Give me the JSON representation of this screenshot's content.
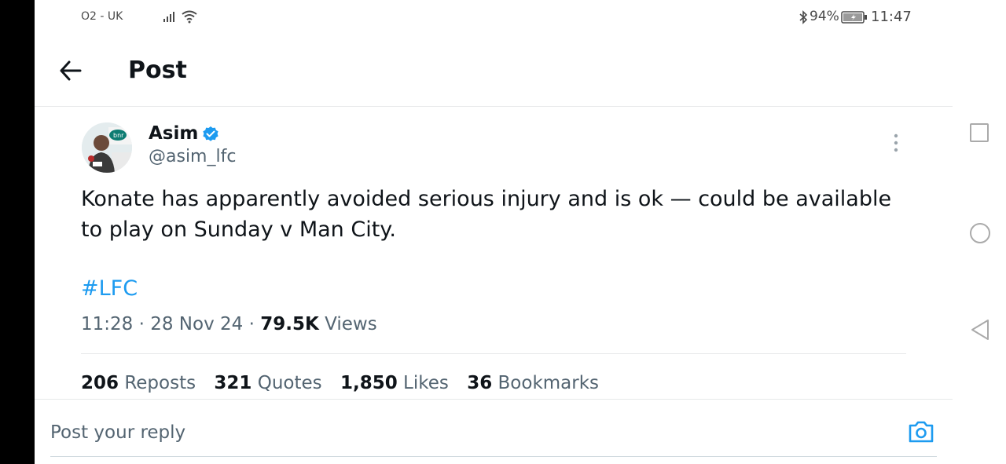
{
  "status_bar": {
    "carrier": "O2 - UK",
    "battery": "94%",
    "time": "11:47",
    "icons": [
      "signal-icon",
      "wifi-icon",
      "bluetooth-icon",
      "battery-icon"
    ]
  },
  "header": {
    "title": "Post",
    "back_icon": "arrow-left-icon"
  },
  "post": {
    "author_name": "Asim",
    "verified": true,
    "handle": "@asim_lfc",
    "text": "Konate has apparently avoided serious injury and is ok — could be available to play on Sunday v Man City.",
    "hashtag": "#LFC",
    "time": "11:28",
    "date": "28 Nov 24",
    "views_count": "79.5K",
    "views_label": "Views",
    "separator": "·"
  },
  "stats": [
    {
      "count": "206",
      "label": "Reposts"
    },
    {
      "count": "321",
      "label": "Quotes"
    },
    {
      "count": "1,850",
      "label": "Likes"
    },
    {
      "count": "36",
      "label": "Bookmarks"
    }
  ],
  "reply": {
    "placeholder": "Post your reply"
  },
  "colors": {
    "accent": "#1d9bf0",
    "text": "#0f1419",
    "muted": "#536471",
    "divider": "#e7e9ea"
  },
  "android_nav": [
    "recents-icon",
    "home-icon",
    "back-icon"
  ]
}
